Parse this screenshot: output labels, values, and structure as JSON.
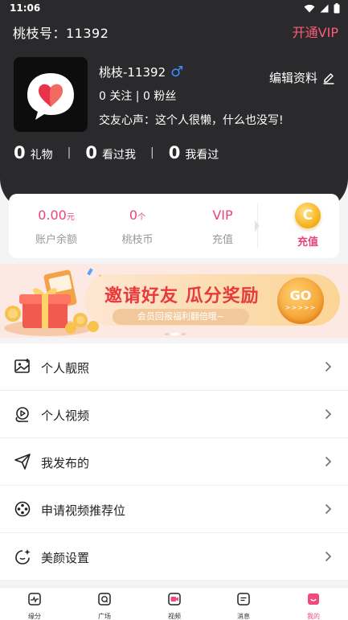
{
  "status_bar": {
    "time": "11:06"
  },
  "header": {
    "id_label": "桃枝号：11392",
    "vip_link": "开通VIP",
    "nickname": "桃枝-11392",
    "gender_symbol": "♂",
    "edit_profile": "编辑资料",
    "follow_info": "0 关注 | 0 粉丝",
    "bio": "交友心声：这个人很懒，什么也没写!",
    "stats": [
      {
        "value": "0",
        "label": "礼物"
      },
      {
        "value": "0",
        "label": "看过我"
      },
      {
        "value": "0",
        "label": "我看过"
      }
    ],
    "stat_separator": "|"
  },
  "wallet": {
    "balance_value": "0.00",
    "balance_unit": "元",
    "balance_label": "账户余额",
    "coins_value": "0",
    "coins_unit": "个",
    "coins_label": "桃枝币",
    "vip_value": "VIP",
    "vip_label": "充值",
    "recharge_label": "充值",
    "coin_icon_letter": "C"
  },
  "banner": {
    "title": "邀请好友 瓜分奖励",
    "subtitle": "会员回报福利翻倍哦~",
    "go_text": "GO",
    "go_arrows": ">>>>>"
  },
  "menu": {
    "items": [
      {
        "label": "个人靓照",
        "icon": "photo-icon"
      },
      {
        "label": "个人视频",
        "icon": "video-icon"
      },
      {
        "label": "我发布的",
        "icon": "send-icon"
      },
      {
        "label": "申请视频推荐位",
        "icon": "film-reel-icon"
      },
      {
        "label": "美颜设置",
        "icon": "beauty-icon"
      }
    ]
  },
  "tabbar": {
    "items": [
      {
        "label": "缘分"
      },
      {
        "label": "广场"
      },
      {
        "label": "视频"
      },
      {
        "label": "消息"
      },
      {
        "label": "我的"
      }
    ],
    "active_index": 4
  },
  "colors": {
    "accent": "#ef4b7c",
    "header_bg": "#2a2a2c",
    "vip_pink": "#ff5c7a",
    "gender_blue": "#3d8bff"
  }
}
